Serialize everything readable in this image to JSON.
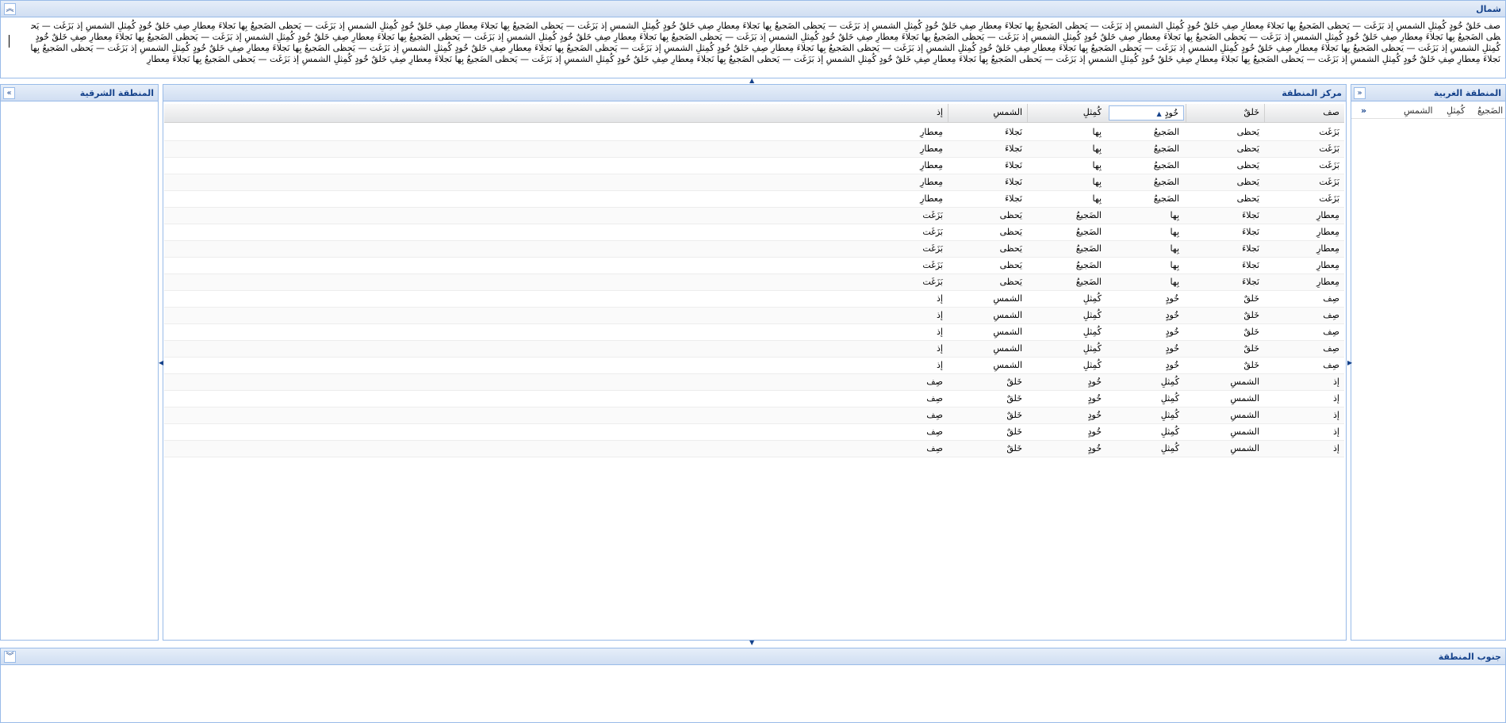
{
  "north": {
    "title": "شمال",
    "collapse_icon": "chevron-double-up-icon",
    "text": "صف خَلقٌ خُودٍ كُمِثلِ الشمسِ إذ بَزَغَت — يَحظى الضَجيعُ بِها نَجلاءَ مِعطارِ صِفِ خَلقٌ خُودٍ كُمِثلِ الشمسِ إذ بَزَغَت — يَحظى الضَجيعُ بِها نَجلاءَ مِعطارِ صِفِ خَلقٌ خُودٍ كُمِثلِ الشمسِ إذ بَزَغَت — يَحظى الضَجيعُ بِها نَجلاءَ مِعطارِ صِفِ خَلقٌ خُودٍ كُمِثلِ الشمسِ إذ بَزَغَت — يَحظى الضَجيعُ بِها نَجلاءَ مِعطارِ صِفِ خَلقٌ خُودٍ كُمِثلِ الشمسِ إذ بَزَغَت — يَحظى الضَجيعُ بِها نَجلاءَ مِعطارِ صِفِ خَلقٌ خُودٍ كُمِثلِ الشمسِ إذ بَزَغَت — يَحظى الضَجيعُ بِها نَجلاءَ مِعطارِ صِفِ خَلقٌ خُودٍ كُمِثلِ الشمسِ إذ بَزَغَت — يَحظى الضَجيعُ بِها نَجلاءَ مِعطارِ صِفِ خَلقٌ خُودٍ كُمِثلِ الشمسِ إذ بَزَغَت — يَحظى الضَجيعُ بِها نَجلاءَ مِعطارِ صِفِ خَلقٌ خُودٍ كُمِثلِ الشمسِ إذ بَزَغَت — يَحظى الضَجيعُ بِها نَجلاءَ مِعطارِ صِفِ خَلقٌ خُودٍ كُمِثلِ الشمسِ إذ بَزَغَت — يَحظى الضَجيعُ بِها نَجلاءَ مِعطارِ صِفِ خَلقٌ خُودٍ كُمِثلِ الشمسِ إذ بَزَغَت — يَحظى الضَجيعُ بِها نَجلاءَ مِعطارِ صِفِ خَلقٌ خُودٍ كُمِثلِ الشمسِ إذ بَزَغَت — يَحظى الضَجيعُ بِها نَجلاءَ مِعطارِ صِفِ خَلقٌ خُودٍ كُمِثلِ الشمسِ إذ بَزَغَت — يَحظى الضَجيعُ بِها نَجلاءَ مِعطارِ صِفِ خَلقٌ خُودٍ كُمِثلِ الشمسِ إذ بَزَغَت — يَحظى الضَجيعُ بِها نَجلاءَ مِعطارِ صِفِ خَلقٌ خُودٍ كُمِثلِ الشمسِ إذ بَزَغَت — يَحظى الضَجيعُ بِها نَجلاءَ مِعطارِ صِفِ خَلقٌ خُودٍ كُمِثلِ الشمسِ إذ بَزَغَت — يَحظى الضَجيعُ بِها نَجلاءَ مِعطارِ صِفِ خَلقٌ خُودٍ كُمِثلِ الشمسِ إذ بَزَغَت — يَحظى الضَجيعُ بِها نَجلاءَ مِعطارِ صِفِ خَلقٌ خُودٍ كُمِثلِ الشمسِ إذ بَزَغَت — يَحظى الضَجيعُ بِها نَجلاءَ مِعطارِ صِفِ خَلقٌ خُودٍ كُمِثلِ الشمسِ إذ بَزَغَت — يَحظى الضَجيعُ بِها نَجلاءَ مِعطارِ صِفِ خَلقٌ خُودٍ كُمِثلِ الشمسِ إذ بَزَغَت — يَحظى الضَجيعُ بِها نَجلاءَ مِعطارِ صِفِ خَلقٌ خُودٍ كُمِثلِ الشمسِ إذ بَزَغَت — يَحظى الضَجيعُ بِها نَجلاءَ مِعطارِ صِفِ خَلقٌ خُودٍ كُمِثلِ الشمسِ إذ بَزَغَت — يَحظى الضَجيعُ بِها نَجلاءَ مِعطارِ"
  },
  "west": {
    "title": "المنطقة الغربية",
    "collapse_icon": "chevron-double-left-icon",
    "expand_icon": "chevron-double-right-icon",
    "headers": [
      "الضَجيعُ",
      "كُمِثلِ",
      "الشمسِ"
    ]
  },
  "center": {
    "title": "مركز المنطقة",
    "columns": [
      "صف",
      "خَلقٌ",
      "خُودٍ",
      "كُمِثلِ",
      "الشمسِ",
      "إذ"
    ],
    "sorted_column_index": 2,
    "sort_icon": "sort-ascending-icon",
    "rows": [
      [
        "بَزَغَت",
        "يَحظى",
        "الضَجيعُ",
        "بِها",
        "نَجلاءَ",
        "مِعطارِ"
      ],
      [
        "بَزَغَت",
        "يَحظى",
        "الضَجيعُ",
        "بِها",
        "نَجلاءَ",
        "مِعطارِ"
      ],
      [
        "بَزَغَت",
        "يَحظى",
        "الضَجيعُ",
        "بِها",
        "نَجلاءَ",
        "مِعطارِ"
      ],
      [
        "بَزَغَت",
        "يَحظى",
        "الضَجيعُ",
        "بِها",
        "نَجلاءَ",
        "مِعطارِ"
      ],
      [
        "بَزَغَت",
        "يَحظى",
        "الضَجيعُ",
        "بِها",
        "نَجلاءَ",
        "مِعطارِ"
      ],
      [
        "مِعطارِ",
        "نَجلاءَ",
        "بِها",
        "الضَجيعُ",
        "يَحظى",
        "بَزَغَت"
      ],
      [
        "مِعطارِ",
        "نَجلاءَ",
        "بِها",
        "الضَجيعُ",
        "يَحظى",
        "بَزَغَت"
      ],
      [
        "مِعطارِ",
        "نَجلاءَ",
        "بِها",
        "الضَجيعُ",
        "يَحظى",
        "بَزَغَت"
      ],
      [
        "مِعطارِ",
        "نَجلاءَ",
        "بِها",
        "الضَجيعُ",
        "يَحظى",
        "بَزَغَت"
      ],
      [
        "مِعطارِ",
        "نَجلاءَ",
        "بِها",
        "الضَجيعُ",
        "يَحظى",
        "بَزَغَت"
      ],
      [
        "صِف",
        "خَلقٌ",
        "خُودٍ",
        "كُمِثلِ",
        "الشمسِ",
        "إذ"
      ],
      [
        "صِف",
        "خَلقٌ",
        "خُودٍ",
        "كُمِثلِ",
        "الشمسِ",
        "إذ"
      ],
      [
        "صِف",
        "خَلقٌ",
        "خُودٍ",
        "كُمِثلِ",
        "الشمسِ",
        "إذ"
      ],
      [
        "صِف",
        "خَلقٌ",
        "خُودٍ",
        "كُمِثلِ",
        "الشمسِ",
        "إذ"
      ],
      [
        "صِف",
        "خَلقٌ",
        "خُودٍ",
        "كُمِثلِ",
        "الشمسِ",
        "إذ"
      ],
      [
        "إذ",
        "الشمسِ",
        "كُمِثلِ",
        "خُودٍ",
        "خَلقٌ",
        "صِف"
      ],
      [
        "إذ",
        "الشمسِ",
        "كُمِثلِ",
        "خُودٍ",
        "خَلقٌ",
        "صِف"
      ],
      [
        "إذ",
        "الشمسِ",
        "كُمِثلِ",
        "خُودٍ",
        "خَلقٌ",
        "صِف"
      ],
      [
        "إذ",
        "الشمسِ",
        "كُمِثلِ",
        "خُودٍ",
        "خَلقٌ",
        "صِف"
      ],
      [
        "إذ",
        "الشمسِ",
        "كُمِثلِ",
        "خُودٍ",
        "خَلقٌ",
        "صِف"
      ]
    ]
  },
  "east": {
    "title": "المنطقة الشرقية",
    "collapse_icon": "chevron-double-right-icon"
  },
  "south": {
    "title": "جنوب المنطقة",
    "collapse_icon": "chevron-double-down-icon"
  }
}
